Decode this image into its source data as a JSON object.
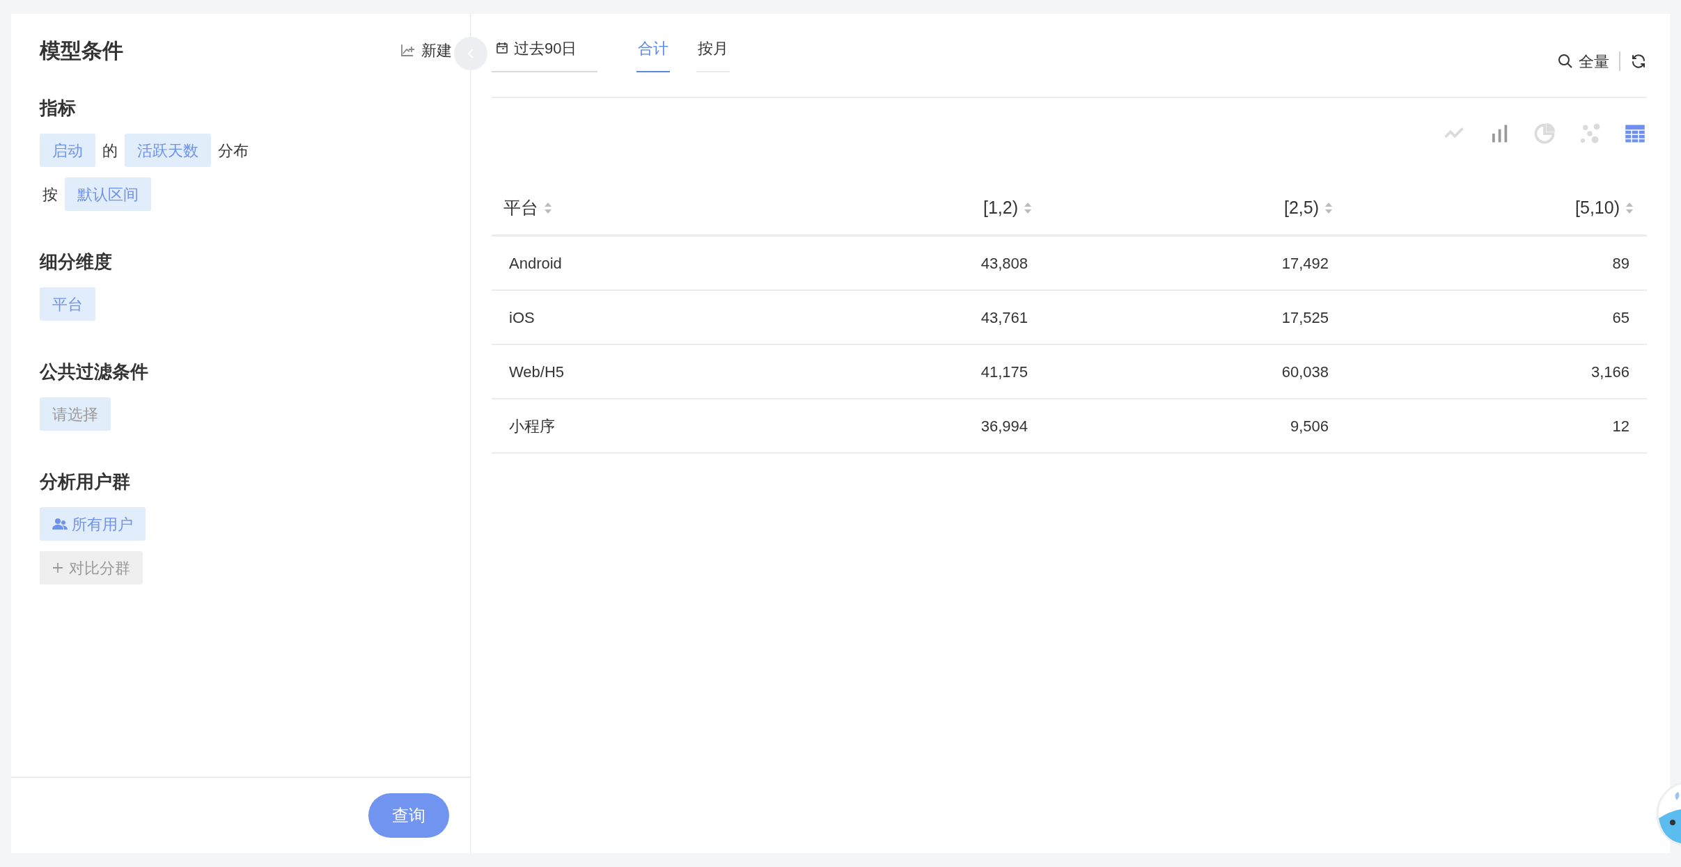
{
  "panel": {
    "title": "模型条件",
    "new_button": "新建"
  },
  "sections": [
    {
      "title": "指标",
      "rows": [
        [
          {
            "kind": "chip",
            "text": "启动"
          },
          {
            "kind": "word",
            "text": "的"
          },
          {
            "kind": "chip",
            "text": "活跃天数"
          },
          {
            "kind": "word",
            "text": "分布"
          }
        ],
        [
          {
            "kind": "word",
            "text": "按"
          },
          {
            "kind": "chip",
            "text": "默认区间"
          }
        ]
      ]
    },
    {
      "title": "细分维度",
      "rows": [
        [
          {
            "kind": "chip",
            "text": "平台"
          }
        ]
      ]
    },
    {
      "title": "公共过滤条件",
      "rows": [
        [
          {
            "kind": "placeholder",
            "text": "请选择"
          }
        ]
      ]
    },
    {
      "title": "分析用户群",
      "rows": [
        [
          {
            "kind": "users",
            "text": "所有用户"
          }
        ],
        [
          {
            "kind": "add",
            "text": "对比分群"
          }
        ]
      ]
    }
  ],
  "query_button": "查询",
  "toolbar": {
    "date_range": "过去90日",
    "tabs": [
      {
        "label": "合计",
        "selected": true
      },
      {
        "label": "按月",
        "selected": false
      }
    ],
    "search": "全量"
  },
  "chart_types": [
    {
      "kind": "line",
      "selected": false,
      "disabled": true
    },
    {
      "kind": "bar",
      "selected": false,
      "disabled": false
    },
    {
      "kind": "pie",
      "selected": false,
      "disabled": true
    },
    {
      "kind": "scatter",
      "selected": false,
      "disabled": true
    },
    {
      "kind": "table",
      "selected": true,
      "disabled": false
    }
  ],
  "table": {
    "columns": [
      "平台",
      "[1,2)",
      "[2,5)",
      "[5,10)"
    ],
    "rows": [
      [
        "Android",
        "43,808",
        "17,492",
        "89"
      ],
      [
        "iOS",
        "43,761",
        "17,525",
        "65"
      ],
      [
        "Web/H5",
        "41,175",
        "60,038",
        "3,166"
      ],
      [
        "小程序",
        "36,994",
        "9,506",
        "12"
      ]
    ]
  }
}
